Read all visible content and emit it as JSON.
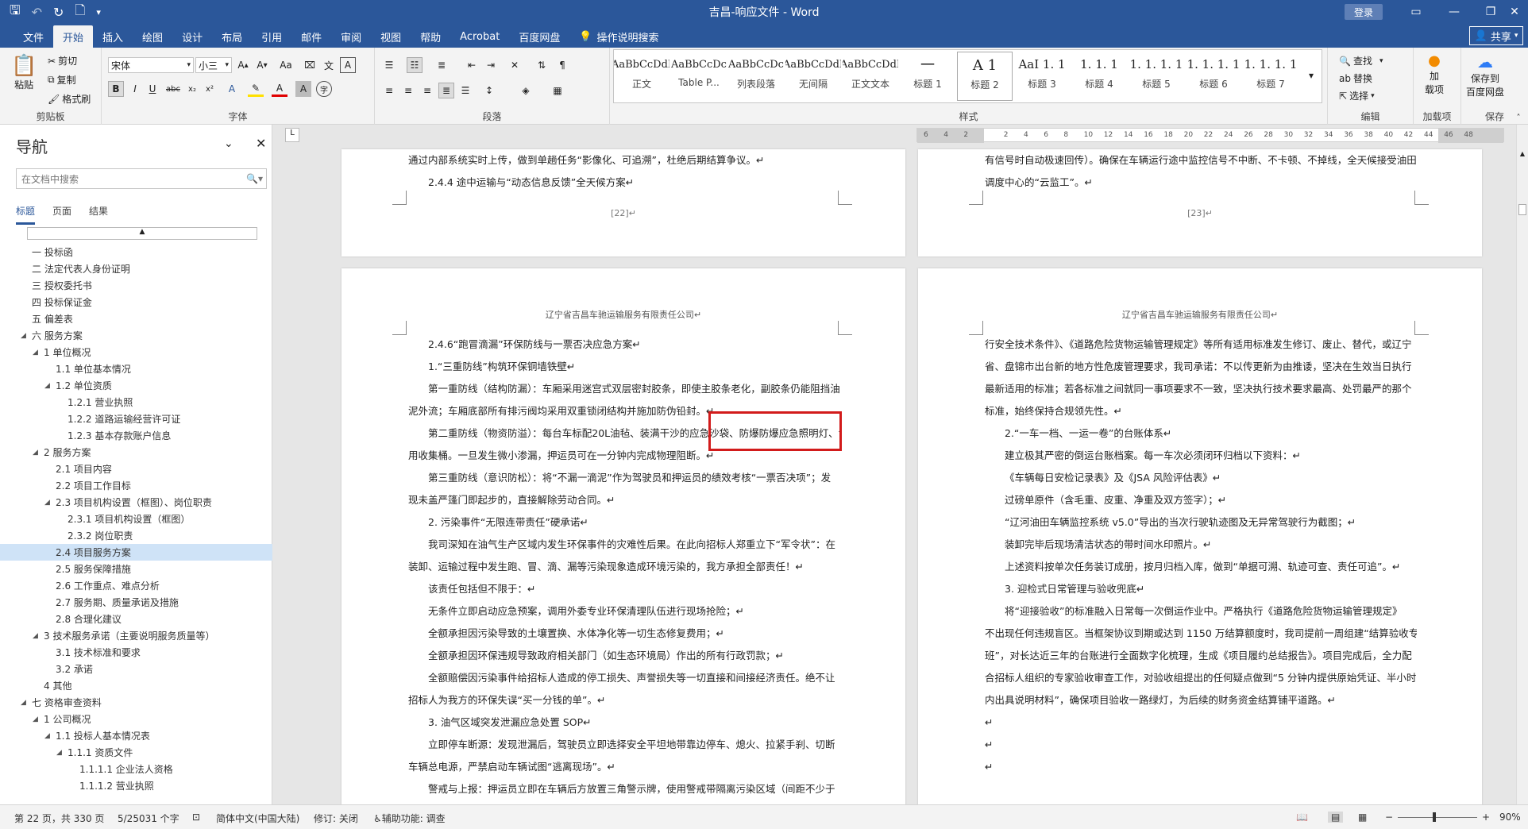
{
  "window": {
    "title": "吉昌-响应文件 - Word",
    "login": "登录"
  },
  "tabs": [
    "文件",
    "开始",
    "插入",
    "绘图",
    "设计",
    "布局",
    "引用",
    "邮件",
    "审阅",
    "视图",
    "帮助",
    "Acrobat",
    "百度网盘"
  ],
  "tell_me": "操作说明搜索",
  "share": "共享",
  "ribbon": {
    "clipboard": {
      "paste": "粘贴",
      "cut": "剪切",
      "copy": "复制",
      "painter": "格式刷",
      "label": "剪贴板"
    },
    "font": {
      "name": "宋体",
      "size": "小三",
      "label": "字体"
    },
    "paragraph": {
      "label": "段落"
    },
    "styles": {
      "label": "样式",
      "items": [
        {
          "preview": "AaBbCcDdI",
          "name": "正文"
        },
        {
          "preview": "AaBbCcDc",
          "name": "Table P..."
        },
        {
          "preview": "AaBbCcDc",
          "name": "列表段落"
        },
        {
          "preview": "AaBbCcDdI",
          "name": "无间隔"
        },
        {
          "preview": "AaBbCcDdI",
          "name": "正文文本"
        },
        {
          "preview": "一",
          "name": "标题 1"
        },
        {
          "preview": "A 1",
          "name": "标题 2"
        },
        {
          "preview": "AaI 1. 1",
          "name": "标题 3"
        },
        {
          "preview": "1. 1. 1",
          "name": "标题 4"
        },
        {
          "preview": "1. 1. 1. 1",
          "name": "标题 5"
        },
        {
          "preview": "1. 1. 1. 1",
          "name": "标题 6"
        },
        {
          "preview": "1. 1. 1. 1",
          "name": "标题 7"
        }
      ]
    },
    "editing": {
      "find": "查找",
      "replace": "替换",
      "select": "选择",
      "label": "编辑"
    },
    "addins": {
      "label_top": "加",
      "label_mid": "载项",
      "group": "加载项"
    },
    "baidu": {
      "line1": "保存到",
      "line2": "百度网盘",
      "group": "保存"
    }
  },
  "nav": {
    "title": "导航",
    "search_placeholder": "在文档中搜索",
    "tabs": [
      "标题",
      "页面",
      "结果"
    ],
    "items": [
      {
        "text": "一 投标函",
        "level": 1,
        "tri": ""
      },
      {
        "text": "二 法定代表人身份证明",
        "level": 1,
        "tri": ""
      },
      {
        "text": "三 授权委托书",
        "level": 1,
        "tri": ""
      },
      {
        "text": "四 投标保证金",
        "level": 1,
        "tri": ""
      },
      {
        "text": "五 偏差表",
        "level": 1,
        "tri": ""
      },
      {
        "text": "六 服务方案",
        "level": 1,
        "tri": "◢"
      },
      {
        "text": "1 单位概况",
        "level": 2,
        "tri": "◢"
      },
      {
        "text": "1.1 单位基本情况",
        "level": 3,
        "tri": ""
      },
      {
        "text": "1.2 单位资质",
        "level": 3,
        "tri": "◢"
      },
      {
        "text": "1.2.1 营业执照",
        "level": 4,
        "tri": ""
      },
      {
        "text": "1.2.2 道路运输经营许可证",
        "level": 4,
        "tri": ""
      },
      {
        "text": "1.2.3 基本存款账户信息",
        "level": 4,
        "tri": ""
      },
      {
        "text": "2 服务方案",
        "level": 2,
        "tri": "◢"
      },
      {
        "text": "2.1 项目内容",
        "level": 3,
        "tri": ""
      },
      {
        "text": "2.2 项目工作目标",
        "level": 3,
        "tri": ""
      },
      {
        "text": "2.3 项目机构设置（框图）、岗位职责",
        "level": 3,
        "tri": "◢"
      },
      {
        "text": "2.3.1 项目机构设置（框图）",
        "level": 4,
        "tri": ""
      },
      {
        "text": "2.3.2 岗位职责",
        "level": 4,
        "tri": ""
      },
      {
        "text": "2.4 项目服务方案",
        "level": 3,
        "tri": "",
        "selected": true
      },
      {
        "text": "2.5 服务保障措施",
        "level": 3,
        "tri": ""
      },
      {
        "text": "2.6 工作重点、难点分析",
        "level": 3,
        "tri": ""
      },
      {
        "text": "2.7 服务期、质量承诺及措施",
        "level": 3,
        "tri": ""
      },
      {
        "text": "2.8 合理化建议",
        "level": 3,
        "tri": ""
      },
      {
        "text": "3 技术服务承诺（主要说明服务质量等）",
        "level": 2,
        "tri": "◢"
      },
      {
        "text": "3.1 技术标准和要求",
        "level": 3,
        "tri": ""
      },
      {
        "text": "3.2 承诺",
        "level": 3,
        "tri": ""
      },
      {
        "text": "4 其他",
        "level": 2,
        "tri": ""
      },
      {
        "text": "七 资格审查资料",
        "level": 1,
        "tri": "◢"
      },
      {
        "text": "1 公司概况",
        "level": 2,
        "tri": "◢"
      },
      {
        "text": "1.1 投标人基本情况表",
        "level": 3,
        "tri": "◢"
      },
      {
        "text": "1.1.1 资质文件",
        "level": 4,
        "tri": "◢"
      },
      {
        "text": "1.1.1.1 企业法人资格",
        "level": 5,
        "tri": ""
      },
      {
        "text": "1.1.1.2 营业执照",
        "level": 5,
        "tri": ""
      }
    ]
  },
  "ruler": [
    "6",
    "4",
    "2",
    "",
    "2",
    "4",
    "6",
    "8",
    "10",
    "12",
    "14",
    "16",
    "18",
    "20",
    "22",
    "24",
    "26",
    "28",
    "30",
    "32",
    "34",
    "36",
    "38",
    "40",
    "42",
    "44",
    "46",
    "48"
  ],
  "doc": {
    "page22_top": {
      "lines": [
        "通过内部系统实时上传，做到单趟任务“影像化、可追溯”，杜绝后期结算争议。↵",
        "2.4.4 途中运输与“动态信息反馈”全天候方案↵"
      ],
      "num": "[22]↵"
    },
    "page23_top": {
      "lines": [
        "有信号时自动极速回传）。确保在车辆运行途中监控信号不中断、不卡顿、不掉线，全天候接受油田",
        "调度中心的“云监工”。↵"
      ],
      "num": "[23]↵"
    },
    "header": "辽宁省吉昌车驰运输服务有限责任公司↵",
    "left_lines": [
      "2.4.6“跑冒滴漏”环保防线与一票否决应急方案↵",
      "1.“三重防线”构筑环保铜墙铁壁↵",
      "第一重防线（结构防漏）：车厢采用迷宫式双层密封胶条，即使主胶条老化，副胶条仍能阻挡油",
      "泥外流；车厢底部所有排污阀均采用双重锁闭结构并施加防伪铅封。↵",
      "第二重防线（物资防溢）：每台车标配20L油毡、装满干沙的应急沙袋、防爆防爆应急照明灯、专",
      "用收集桶。一旦发生微小渗漏，押运员可在一分钟内完成物理阻断。↵",
      "第三重防线（意识防松）：将“不漏一滴泥”作为驾驶员和押运员的绩效考核“一票否决项”；发",
      "现未盖严篷门即起步的，直接解除劳动合同。↵",
      "2. 污染事件“无限连带责任”硬承诺↵",
      "我司深知在油气生产区域内发生环保事件的灾难性后果。在此向招标人郑重立下“军令状”：在",
      "装卸、运输过程中发生跑、冒、滴、漏等污染现象造成环境污染的，我方承担全部责任！↵",
      "该责任包括但不限于：↵",
      "无条件立即启动应急预案，调用外委专业环保清理队伍进行现场抢险；↵",
      "全额承担因污染导致的土壤置换、水体净化等一切生态修复费用；↵",
      "全额承担因环保违规导致政府相关部门（如生态环境局）作出的所有行政罚款；↵",
      "全额赔偿因污染事件给招标人造成的停工损失、声誉损失等一切直接和间接经济责任。绝不让",
      "招标人为我方的环保失误“买一分钱的单”。↵",
      "3. 油气区域突发泄漏应急处置 SOP↵",
      "立即停车断源：发现泄漏后，驾驶员立即选择安全平坦地带靠边停车、熄火、拉紧手刹、切断",
      "车辆总电源，严禁启动车辆试图“逃离现场”。↵",
      "警戒与上报：押运员立即在车辆后方放置三角警示牌，使用警戒带隔离污染区域（间距不少于"
    ],
    "right_lines": [
      "行安全技术条件》、《道路危险货物运输管理规定》等所有适用标准发生修订、废止、替代，或辽宁",
      "省、盘锦市出台新的地方性危废管理要求，我司承诺：不以传更新为由推诿，坚决在生效当日执行",
      "最新适用的标准；若各标准之间就同一事项要求不一致，坚决执行技术要求最高、处罚最严的那个",
      "标准，始终保持合规领先性。↵",
      "2.“一车一档、一运一卷”的台账体系↵",
      "建立极其严密的倒运台账档案。每一车次必须闭环归档以下资料：↵",
      "《车辆每日安检记录表》及《JSA 风险评估表》↵",
      "过磅单原件（含毛重、皮重、净重及双方签字）；↵",
      "“辽河油田车辆监控系统 v5.0”导出的当次行驶轨迹图及无异常驾驶行为截图；↵",
      "装卸完毕后现场清洁状态的带时间水印照片。↵",
      "上述资料按单次任务装订成册，按月归档入库，做到“单据可溯、轨迹可查、责任可追”。↵",
      "3. 迎检式日常管理与验收兜底↵",
      "将“迎接验收”的标准融入日常每一次倒运作业中。严格执行《道路危险货物运输管理规定》",
      "不出现任何违规盲区。当框架协议到期或达到 1150 万结算额度时，我司提前一周组建“结算验收专",
      "班”，对长达近三年的台账进行全面数字化梳理，生成《项目履约总结报告》。项目完成后，全力配",
      "合招标人组织的专家验收审查工作，对验收组提出的任何疑点做到“5 分钟内提供原始凭证、半小时",
      "内出具说明材料”，确保项目验收一路绿灯，为后续的财务资金结算铺平道路。↵",
      "↵",
      "↵",
      "↵"
    ]
  },
  "status": {
    "page": "第 22 页，共 330 页",
    "words": "5/25031 个字",
    "lang": "简体中文(中国大陆)",
    "track": "修订: 关闭",
    "access": "辅助功能: 调查",
    "zoom": "90%"
  }
}
